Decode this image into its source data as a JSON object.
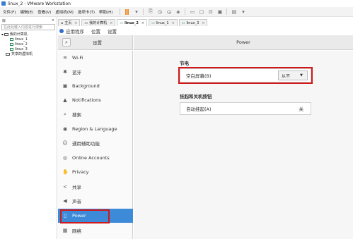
{
  "window": {
    "title": "linux_2 - VMware Workstation"
  },
  "menubar": {
    "items": [
      "文件(F)",
      "编辑(E)",
      "查看(V)",
      "虚拟机(M)",
      "选项卡(T)",
      "帮助(H)"
    ]
  },
  "library": {
    "title": "库",
    "search_placeholder": "在此处键入内容进行搜索",
    "tree": [
      {
        "label": "我的计算机",
        "level": 0
      },
      {
        "label": "linux_1",
        "level": 1
      },
      {
        "label": "linux_2",
        "level": 1
      },
      {
        "label": "linux_3",
        "level": 1
      },
      {
        "label": "共享的虚拟机",
        "level": 0
      }
    ]
  },
  "vm_tabs": [
    {
      "label": "主页",
      "active": false
    },
    {
      "label": "我的计算机",
      "active": false
    },
    {
      "label": "linux_2",
      "active": true
    },
    {
      "label": "linux_1",
      "active": false
    },
    {
      "label": "linux_3",
      "active": false
    }
  ],
  "gnome_bar": {
    "apps": "应用程序",
    "places": "位置",
    "settings": "设置"
  },
  "settings": {
    "header_title": "设置",
    "panel_title": "Power",
    "sidebar": [
      {
        "label": "Wi-Fi",
        "icon": "wifi-icon",
        "glyph": "≋"
      },
      {
        "label": "蓝牙",
        "icon": "bluetooth-icon",
        "glyph": "✱"
      },
      {
        "label": "Background",
        "icon": "background-icon",
        "glyph": "▣"
      },
      {
        "label": "Notifications",
        "icon": "bell-icon",
        "glyph": "▲"
      },
      {
        "label": "搜索",
        "icon": "search-icon",
        "glyph": "⌕"
      },
      {
        "label": "Region & Language",
        "icon": "region-icon",
        "glyph": "◉"
      },
      {
        "label": "通用辅助功能",
        "icon": "accessibility-icon",
        "glyph": "☺"
      },
      {
        "label": "Online Accounts",
        "icon": "accounts-icon",
        "glyph": "◎"
      },
      {
        "label": "Privacy",
        "icon": "privacy-icon",
        "glyph": "✋"
      },
      {
        "label": "共享",
        "icon": "share-icon",
        "glyph": "<"
      },
      {
        "label": "声音",
        "icon": "sound-icon",
        "glyph": "◀"
      },
      {
        "label": "Power",
        "icon": "power-icon",
        "glyph": "▯",
        "active": true
      },
      {
        "label": "网络",
        "icon": "network-icon",
        "glyph": "▦"
      }
    ],
    "power_saving": {
      "title": "节电",
      "blank_screen_label": "空白屏幕(B)",
      "blank_screen_value": "从不"
    },
    "suspend": {
      "title": "挂起和关机按钮",
      "auto_suspend_label": "自动挂起(A)",
      "auto_suspend_value": "关"
    }
  },
  "colors": {
    "accent": "#3d8ad8",
    "highlight": "#d0191a"
  }
}
